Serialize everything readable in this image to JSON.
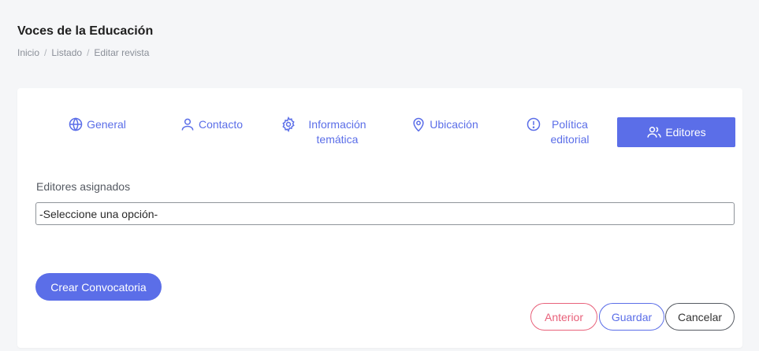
{
  "header": {
    "title": "Voces de la Educación",
    "breadcrumb": [
      "Inicio",
      "Listado",
      "Editar revista"
    ],
    "separator": "/"
  },
  "tabs": [
    {
      "label": "General",
      "icon": "globe-icon"
    },
    {
      "label": "Contacto",
      "icon": "user-icon"
    },
    {
      "label": "Información temática",
      "icon": "gear-icon"
    },
    {
      "label": "Ubicación",
      "icon": "location-pin-icon"
    },
    {
      "label": "Política editorial",
      "icon": "alert-circle-icon"
    },
    {
      "label": "Editores",
      "icon": "users-icon",
      "active": true
    }
  ],
  "form": {
    "editors_label": "Editores asignados",
    "editors_select_value": "-Seleccione una opción-"
  },
  "actions": {
    "create_call": "Crear Convocatoria",
    "previous": "Anterior",
    "save": "Guardar",
    "cancel": "Cancelar"
  },
  "colors": {
    "primary": "#5b6ee8",
    "danger": "#e8617a",
    "background": "#f5f6f8"
  }
}
